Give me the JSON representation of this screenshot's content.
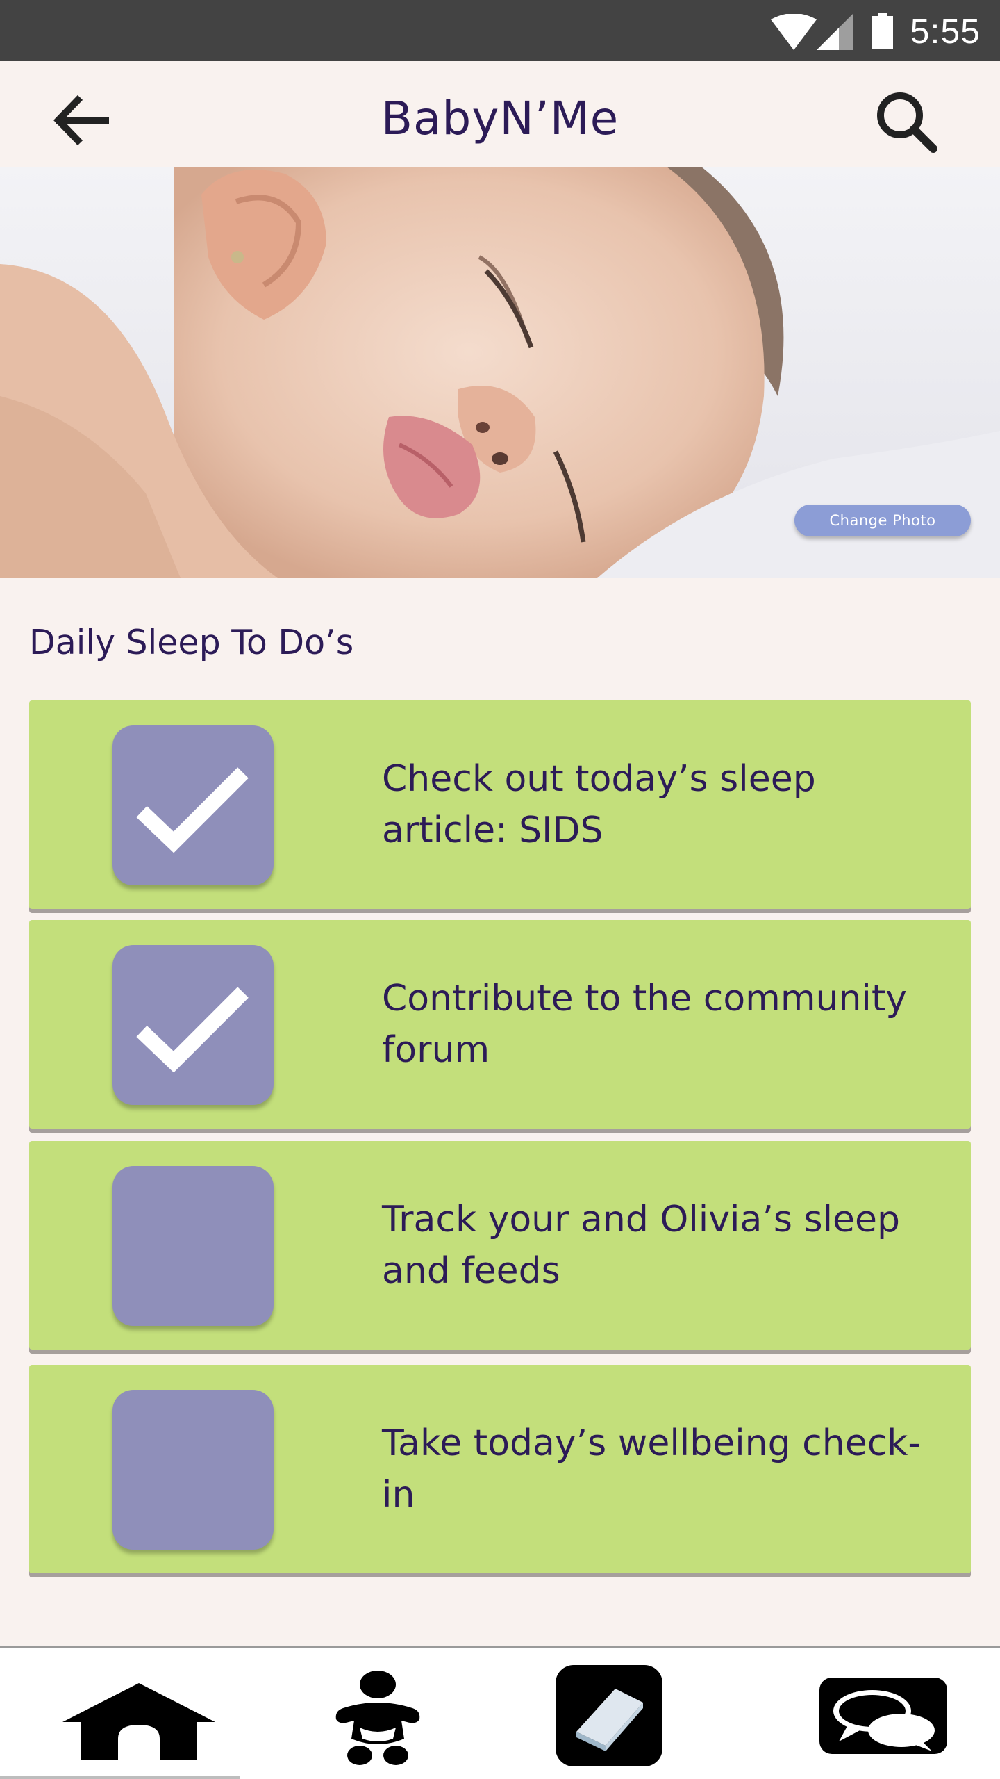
{
  "status_bar": {
    "time": "5:55"
  },
  "app_bar": {
    "title": "BabyN’Me"
  },
  "hero": {
    "change_photo_label": "Change Photo"
  },
  "section": {
    "title": "Daily Sleep To Do’s"
  },
  "todos": [
    {
      "label": "Check out today’s sleep article: SIDS",
      "checked": true
    },
    {
      "label": "Contribute to the community forum",
      "checked": true
    },
    {
      "label": "Track your and Olivia’s sleep and feeds",
      "checked": false
    },
    {
      "label": "Take today’s wellbeing check-in",
      "checked": false
    }
  ],
  "bottom_nav": {
    "items": [
      {
        "name": "home",
        "icon": "home-icon",
        "active": false
      },
      {
        "name": "baby",
        "icon": "baby-icon",
        "active": false
      },
      {
        "name": "journal",
        "icon": "book-icon",
        "active": true
      },
      {
        "name": "community",
        "icon": "chat-bubbles-icon",
        "active": false
      }
    ]
  },
  "colors": {
    "background": "#f9f2ef",
    "brand_text": "#2c1b57",
    "todo_card": "#c3df7b",
    "checkbox": "#8f8fba",
    "change_photo_button": "#8c9dd6",
    "status_bar": "#434343"
  }
}
